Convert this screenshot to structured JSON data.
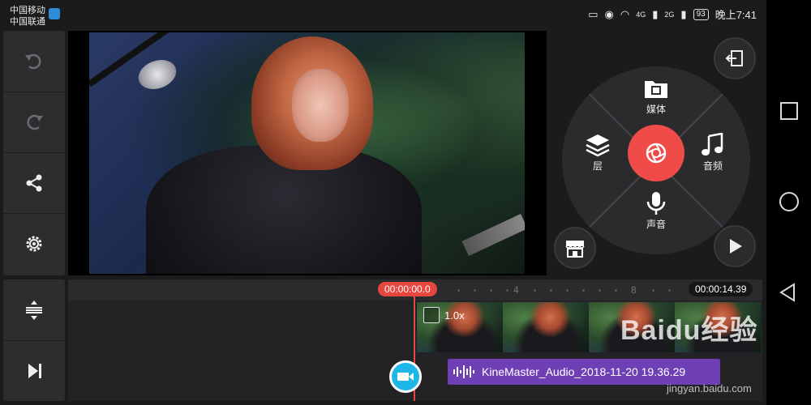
{
  "status_bar": {
    "carrier_1": "中国移动",
    "carrier_2": "中国联通",
    "signal_4g": "4G",
    "signal_2g": "2G",
    "battery": "93",
    "time": "晚上7:41"
  },
  "left_toolbar": {
    "top_buttons": [
      "undo-icon",
      "redo-icon",
      "share-icon",
      "settings-icon"
    ],
    "bottom_buttons": [
      "track-layout-icon",
      "skip-to-end-icon"
    ]
  },
  "radial_menu": {
    "media_label": "媒体",
    "layer_label": "层",
    "audio_label": "音频",
    "voice_label": "声音",
    "accent_color": "#ef4c49"
  },
  "timeline": {
    "current_time": "00:00:00.0",
    "total_time": "00:00:14.39",
    "ruler_ticks": [
      "4",
      "8"
    ],
    "clip_speed": "1.0x",
    "audio_clip_name": "KineMaster_Audio_2018-11-20 19.36.29",
    "audio_color": "#6f3fb5",
    "playhead_color": "#e8473f"
  },
  "watermark": {
    "text": "Baidu经验",
    "sub": "jingyan.baidu.com"
  }
}
